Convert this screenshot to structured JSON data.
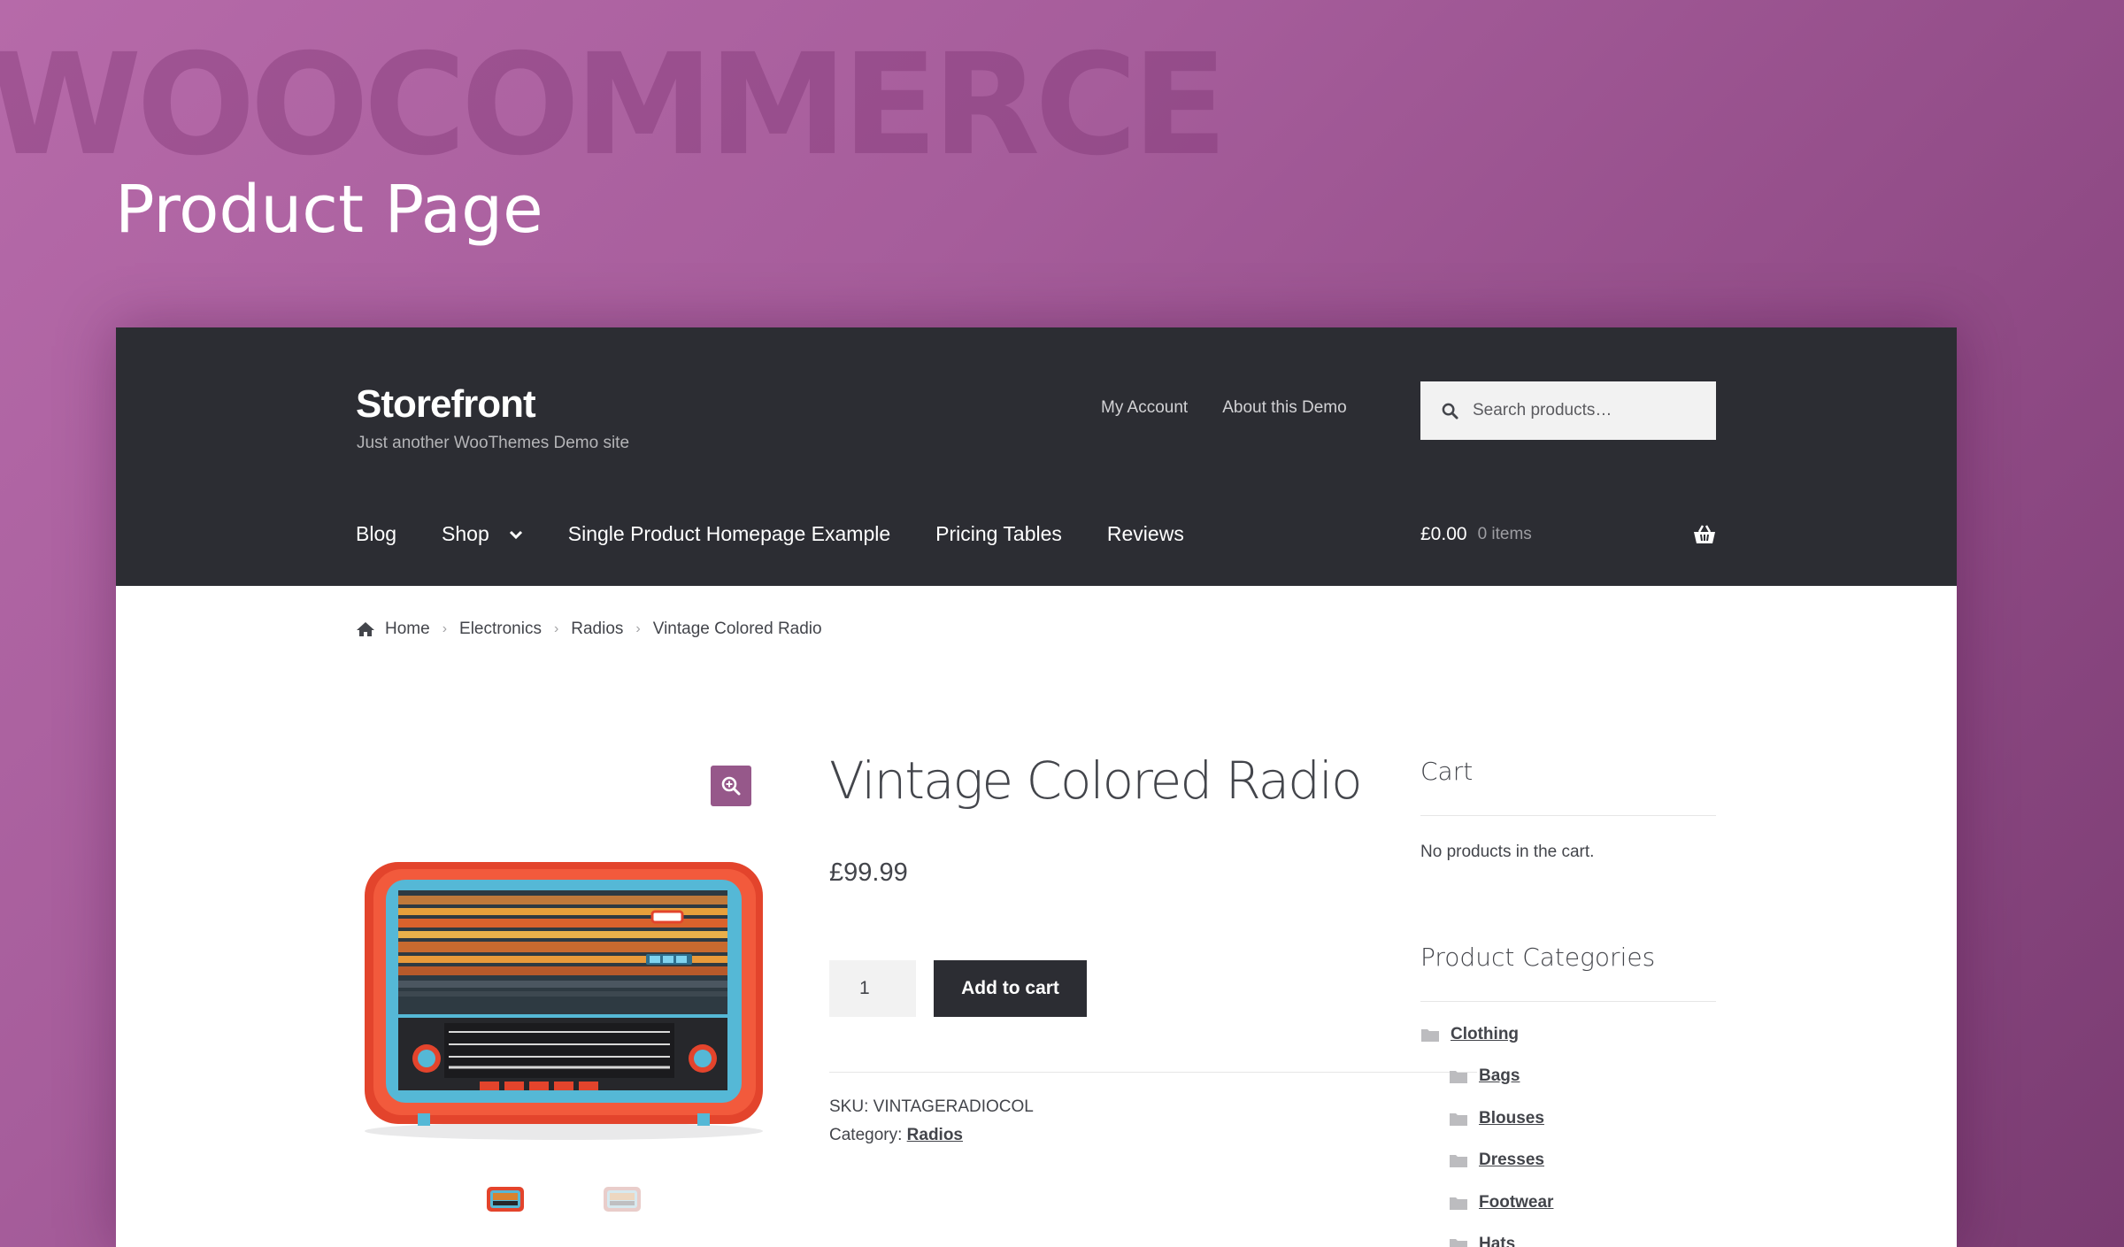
{
  "hero": {
    "watermark": "WOOCOMMERCE",
    "title": "Product Page"
  },
  "header": {
    "site_title": "Storefront",
    "tagline": "Just another WooThemes Demo site",
    "secondary_nav": [
      "My Account",
      "About this Demo"
    ],
    "search_placeholder": "Search products…",
    "primary_nav": {
      "blog": "Blog",
      "shop": "Shop",
      "single": "Single Product Homepage Example",
      "pricing": "Pricing Tables",
      "reviews": "Reviews"
    },
    "cart_amount": "£0.00",
    "cart_count": "0 items"
  },
  "breadcrumb": {
    "home": "Home",
    "level1": "Electronics",
    "level2": "Radios",
    "current": "Vintage Colored Radio"
  },
  "product": {
    "title": "Vintage Colored Radio",
    "price": "£99.99",
    "quantity": "1",
    "add_to_cart": "Add to cart",
    "sku_label": "SKU:",
    "sku": "VINTAGERADIOCOL",
    "category_label": "Category:",
    "category": "Radios"
  },
  "sidebar": {
    "cart_title": "Cart",
    "cart_empty": "No products in the cart.",
    "categories_title": "Product Categories",
    "categories": {
      "clothing": "Clothing",
      "bags": "Bags",
      "blouses": "Blouses",
      "dresses": "Dresses",
      "footwear": "Footwear",
      "hats": "Hats"
    }
  },
  "colors": {
    "accent": "#96588a",
    "header_bg": "#2c2d33",
    "text": "#43454b"
  }
}
